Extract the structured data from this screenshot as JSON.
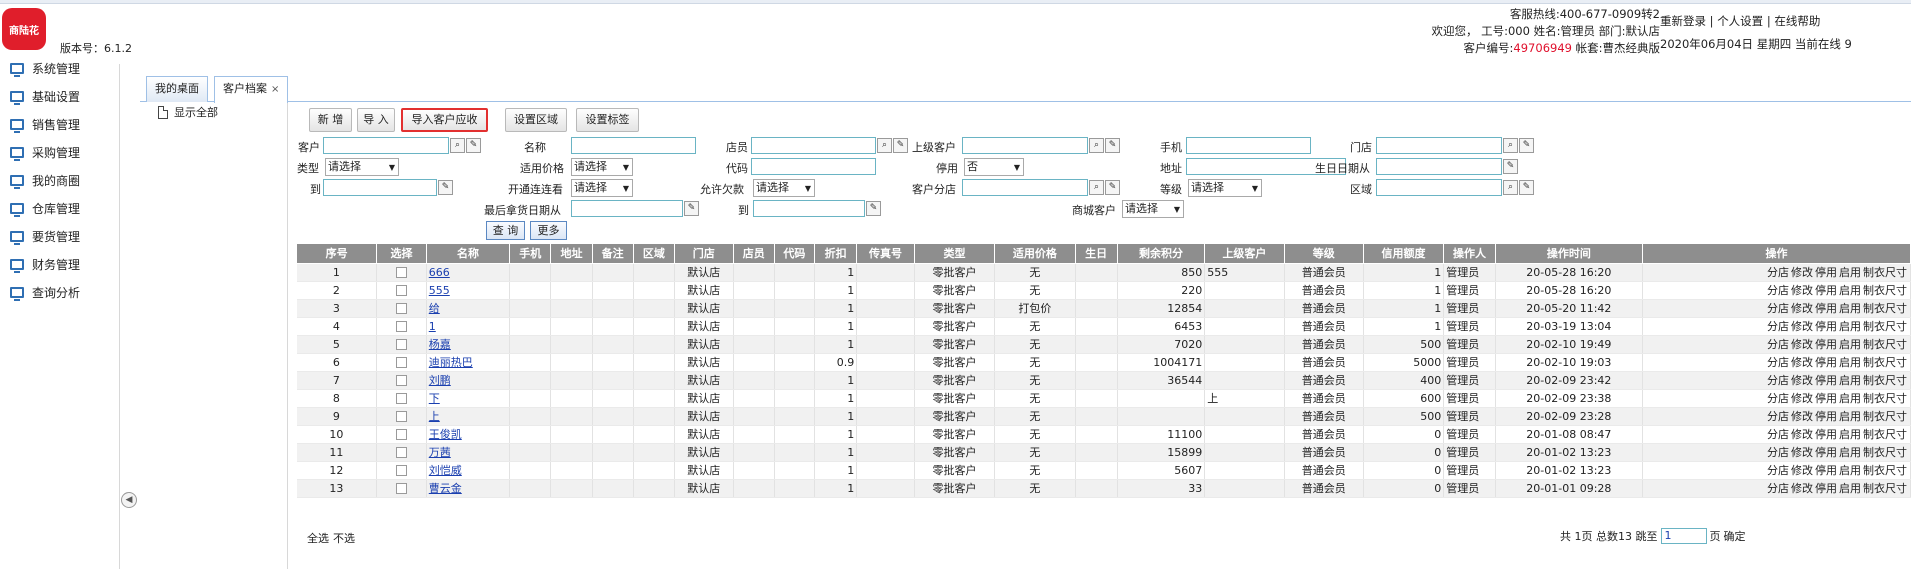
{
  "header": {
    "logo_text": "商陆花",
    "version": "版本号：6.1.2",
    "hotline": "客服热线:400-677-0909转2",
    "welcome": "欢迎您，  工号:000 姓名:管理员 部门:默认店",
    "customer_no_label": "客户编号:",
    "customer_no": "49706949",
    "account_set": " 帐套:曹杰经典版",
    "links": {
      "relogin": "重新登录",
      "personal": "个人设置",
      "help": "在线帮助"
    },
    "date_line": "2020年06月04日 星期四 当前在线 9"
  },
  "sidebar": {
    "items": [
      "系统管理",
      "基础设置",
      "销售管理",
      "采购管理",
      "我的商圈",
      "仓库管理",
      "要货管理",
      "财务管理",
      "查询分析"
    ]
  },
  "tabs": [
    {
      "label": "我的桌面"
    },
    {
      "label": "客户档案",
      "close": "×"
    }
  ],
  "tree": {
    "show_all": "显示全部"
  },
  "toolbar": {
    "new": "新 增",
    "import": "导 入",
    "import_ar": "导入客户应收",
    "set_region": "设置区域",
    "set_tags": "设置标签"
  },
  "filters": {
    "customer": "客户",
    "name": "名称",
    "clerk": "店员",
    "parent_customer": "上级客户",
    "phone": "手机",
    "store": "门店",
    "type": "类型",
    "type_value": "请选择",
    "applicable_price": "适用价格",
    "applicable_price_value": "请选择",
    "code": "代码",
    "disabled": "停用",
    "disabled_value": "否",
    "address": "地址",
    "birthday_from": "生日日期从",
    "to": "到",
    "follow_look": "开通连连看",
    "follow_look_value": "请选择",
    "allow_debt": "允许欠款",
    "allow_debt_value": "请选择",
    "customer_branch": "客户分店",
    "level": "等级",
    "level_value": "请选择",
    "region": "区域",
    "last_pick_from": "最后拿货日期从",
    "to2": "到",
    "mall_customer": "商城客户",
    "mall_customer_value": "请选择",
    "query": "查 询",
    "more": "更多"
  },
  "table": {
    "columns": [
      "序号",
      "选择",
      "名称",
      "手机",
      "地址",
      "备注",
      "区域",
      "门店",
      "店员",
      "代码",
      "折扣",
      "传真号",
      "类型",
      "适用价格",
      "生日",
      "剩余积分",
      "上级客户",
      "等级",
      "信用额度",
      "操作人",
      "操作时间",
      "操作"
    ],
    "ops": [
      "分店",
      "修改",
      "停用",
      "启用",
      "制衣尺寸"
    ],
    "rows": [
      {
        "no": "1",
        "name": "666",
        "store": "默认店",
        "discount": "1",
        "type": "零批客户",
        "price": "无",
        "points": "850",
        "parent": "555",
        "level": "普通会员",
        "credit": "1",
        "operator": "管理员",
        "time": "20-05-28 16:20"
      },
      {
        "no": "2",
        "name": "555",
        "store": "默认店",
        "discount": "1",
        "type": "零批客户",
        "price": "无",
        "points": "220",
        "parent": "",
        "level": "普通会员",
        "credit": "1",
        "operator": "管理员",
        "time": "20-05-28 16:20"
      },
      {
        "no": "3",
        "name": "给",
        "store": "默认店",
        "discount": "1",
        "type": "零批客户",
        "price": "打包价",
        "points": "12854",
        "parent": "",
        "level": "普通会员",
        "credit": "1",
        "operator": "管理员",
        "time": "20-05-20 11:42"
      },
      {
        "no": "4",
        "name": "1",
        "store": "默认店",
        "discount": "1",
        "type": "零批客户",
        "price": "无",
        "points": "6453",
        "parent": "",
        "level": "普通会员",
        "credit": "1",
        "operator": "管理员",
        "time": "20-03-19 13:04"
      },
      {
        "no": "5",
        "name": "杨嘉",
        "store": "默认店",
        "discount": "1",
        "type": "零批客户",
        "price": "无",
        "points": "7020",
        "parent": "",
        "level": "普通会员",
        "credit": "500",
        "operator": "管理员",
        "time": "20-02-10 19:49"
      },
      {
        "no": "6",
        "name": "迪丽热巴",
        "store": "默认店",
        "discount": "0.9",
        "type": "零批客户",
        "price": "无",
        "points": "1004171",
        "parent": "",
        "level": "普通会员",
        "credit": "5000",
        "operator": "管理员",
        "time": "20-02-10 19:03"
      },
      {
        "no": "7",
        "name": "刘鹏",
        "store": "默认店",
        "discount": "1",
        "type": "零批客户",
        "price": "无",
        "points": "36544",
        "parent": "",
        "level": "普通会员",
        "credit": "400",
        "operator": "管理员",
        "time": "20-02-09 23:42"
      },
      {
        "no": "8",
        "name": "下",
        "store": "默认店",
        "discount": "1",
        "type": "零批客户",
        "price": "无",
        "points": "",
        "parent": "上",
        "level": "普通会员",
        "credit": "600",
        "operator": "管理员",
        "time": "20-02-09 23:38"
      },
      {
        "no": "9",
        "name": "上",
        "store": "默认店",
        "discount": "1",
        "type": "零批客户",
        "price": "无",
        "points": "",
        "parent": "",
        "level": "普通会员",
        "credit": "500",
        "operator": "管理员",
        "time": "20-02-09 23:28"
      },
      {
        "no": "10",
        "name": "王俊凯",
        "store": "默认店",
        "discount": "1",
        "type": "零批客户",
        "price": "无",
        "points": "11100",
        "parent": "",
        "level": "普通会员",
        "credit": "0",
        "operator": "管理员",
        "time": "20-01-08 08:47"
      },
      {
        "no": "11",
        "name": "万茜",
        "store": "默认店",
        "discount": "1",
        "type": "零批客户",
        "price": "无",
        "points": "15899",
        "parent": "",
        "level": "普通会员",
        "credit": "0",
        "operator": "管理员",
        "time": "20-01-02 13:23"
      },
      {
        "no": "12",
        "name": "刘恺威",
        "store": "默认店",
        "discount": "1",
        "type": "零批客户",
        "price": "无",
        "points": "5607",
        "parent": "",
        "level": "普通会员",
        "credit": "0",
        "operator": "管理员",
        "time": "20-01-02 13:23"
      },
      {
        "no": "13",
        "name": "曹云金",
        "store": "默认店",
        "discount": "1",
        "type": "零批客户",
        "price": "无",
        "points": "33",
        "parent": "",
        "level": "普通会员",
        "credit": "0",
        "operator": "管理员",
        "time": "20-01-01 09:28"
      }
    ]
  },
  "footer": {
    "select_all": "全选",
    "select_none": "不选",
    "pager_prefix": "共 1页 总数13 跳至",
    "page_value": "1",
    "page_suffix": "页",
    "confirm": "确定"
  }
}
